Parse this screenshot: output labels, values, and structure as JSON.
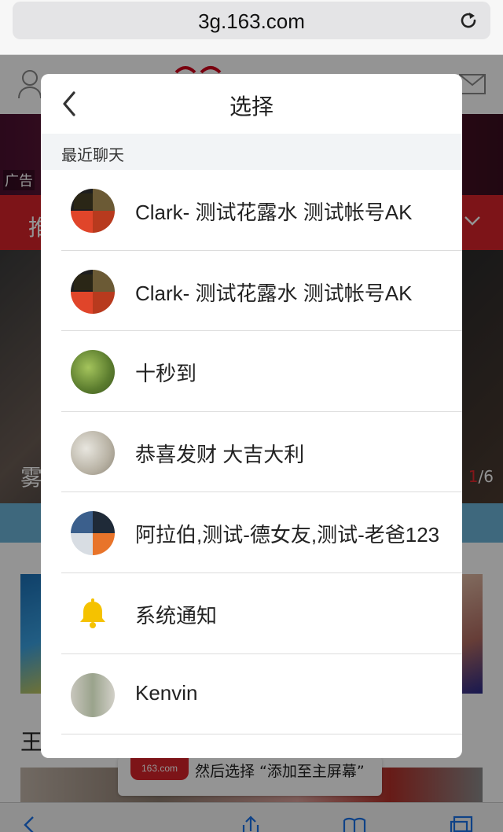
{
  "browser": {
    "url": "3g.163.com",
    "reload_icon": "reload-icon"
  },
  "background_page": {
    "ad_label": "广告",
    "red_bar_text": "推",
    "photo_caption": "雾",
    "photo_counter_current": "1",
    "photo_counter_total": "/6",
    "title_char": "王",
    "hint_logo": "163.com",
    "hint_text": "然后选择 “添加至主屏幕”"
  },
  "modal": {
    "title": "选择",
    "back_icon": "chevron-left-icon",
    "section_title": "最近聊天",
    "chats": [
      {
        "name": "Clark- 测试花露水 测试帐号AK",
        "avatar": "clark"
      },
      {
        "name": "Clark- 测试花露水 测试帐号AK",
        "avatar": "clark"
      },
      {
        "name": "十秒到",
        "avatar": "tree"
      },
      {
        "name": "恭喜发财 大吉大利",
        "avatar": "fluffy"
      },
      {
        "name": "阿拉伯,测试-德女友,测试-老爸123",
        "avatar": "group"
      },
      {
        "name": "系统通知",
        "avatar": "bell"
      },
      {
        "name": "Kenvin",
        "avatar": "kenvin"
      }
    ]
  },
  "colors": {
    "brand_red": "#d8242a",
    "notification_bell": "#f5c200"
  }
}
